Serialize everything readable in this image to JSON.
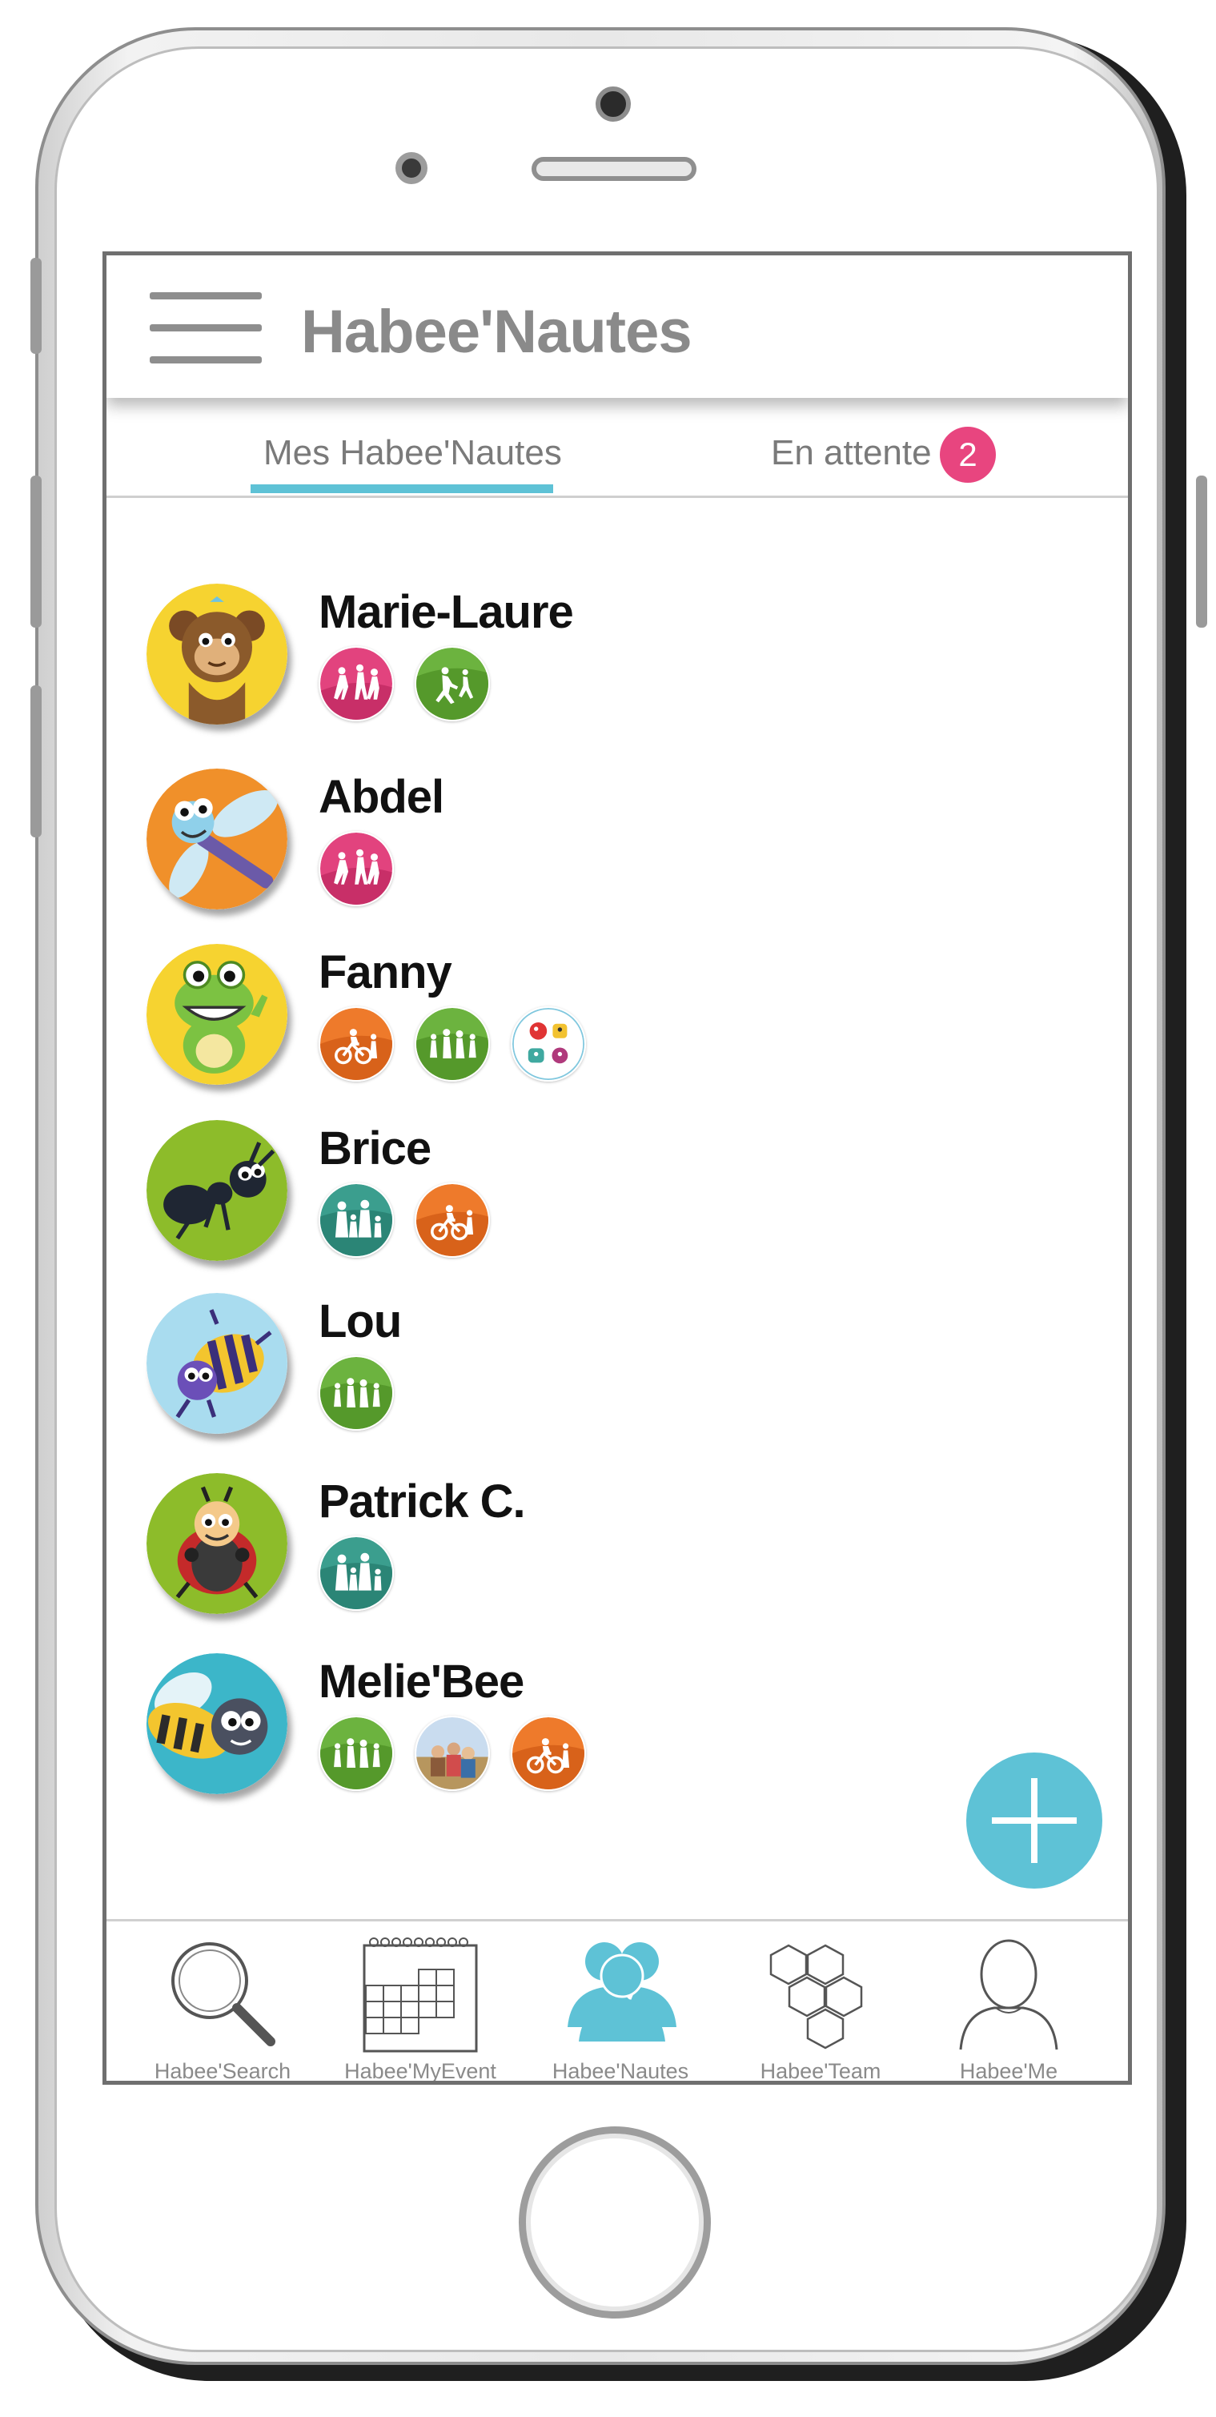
{
  "app": {
    "title": "Habee'Nautes"
  },
  "tabs": {
    "mine_label": "Mes Habee'Nautes",
    "pending_label": "En attente",
    "pending_count": "2"
  },
  "people": [
    {
      "name": "Marie-Laure",
      "avatar": "monkey",
      "activities": [
        "dance-pink",
        "running-green"
      ]
    },
    {
      "name": "Abdel",
      "avatar": "dragonfly",
      "activities": [
        "dance-pink"
      ]
    },
    {
      "name": "Fanny",
      "avatar": "frog",
      "activities": [
        "cycling-orange",
        "walking-green",
        "monsters-white"
      ]
    },
    {
      "name": "Brice",
      "avatar": "ant",
      "activities": [
        "family-teal",
        "cycling-orange"
      ]
    },
    {
      "name": "Lou",
      "avatar": "bee-blue",
      "activities": [
        "walking-green"
      ]
    },
    {
      "name": "Patrick C.",
      "avatar": "ladybug",
      "activities": [
        "family-teal"
      ]
    },
    {
      "name": "Melie'Bee",
      "avatar": "bee",
      "activities": [
        "walking-green",
        "photo-group",
        "cycling-orange"
      ]
    }
  ],
  "nav": [
    {
      "label": "Habee'Search",
      "icon": "search-icon",
      "active": false
    },
    {
      "label": "Habee'MyEvent",
      "icon": "calendar-icon",
      "active": false
    },
    {
      "label": "Habee'Nautes",
      "icon": "people-icon",
      "active": true
    },
    {
      "label": "Habee'Team",
      "icon": "hexagons-icon",
      "active": false
    },
    {
      "label": "Habee'Me",
      "icon": "person-icon",
      "active": false
    }
  ],
  "colors": {
    "accent": "#5ec2d6",
    "badge": "#e8457f",
    "title": "#8a8a8a"
  }
}
